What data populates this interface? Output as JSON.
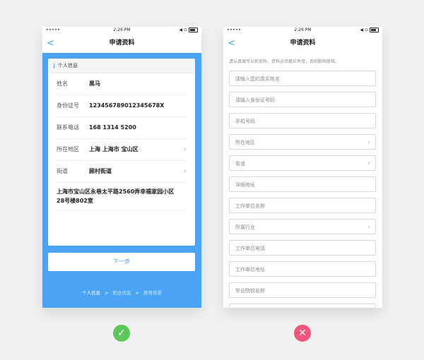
{
  "statusbar": {
    "signal": "•••••",
    "time": "2:26 PM",
    "icons": "◀ ⊙"
  },
  "nav": {
    "back_icon": "<",
    "title": "申请资料"
  },
  "left": {
    "section_title": "个人信息",
    "fields": [
      {
        "label": "姓名",
        "value": "黑马",
        "chevron": false
      },
      {
        "label": "身份证号",
        "value": "123456789012345678X",
        "chevron": false
      },
      {
        "label": "联系电话",
        "value": "168 1314 5200",
        "chevron": false
      },
      {
        "label": "所在地区",
        "value": "上海 上海市 宝山区",
        "chevron": true
      },
      {
        "label": "街道",
        "value": "顾村街道",
        "chevron": true
      }
    ],
    "address_line1": "上海市宝山区永巷太平路2560弄幸福家园小区",
    "address_line2": "28号楼802室",
    "next_button": "下一步",
    "steps": [
      "个人信息",
      "职业信息",
      "教育背景"
    ],
    "step_sep": ">"
  },
  "right": {
    "notice": "请认真填写以前资料，资料必须真实有效，否则影响审核。",
    "inputs": [
      {
        "text": "请输入您的真实姓名",
        "chevron": false
      },
      {
        "text": "请输入身份证号码",
        "chevron": false
      },
      {
        "text": "手机号码",
        "chevron": false
      },
      {
        "text": "所在地区",
        "chevron": true
      },
      {
        "text": "街道",
        "chevron": true
      },
      {
        "text": "详细地址",
        "chevron": false
      },
      {
        "text": "工作单位名称",
        "chevron": false
      },
      {
        "text": "所属行业",
        "chevron": true
      },
      {
        "text": "工作单位电话",
        "chevron": false
      },
      {
        "text": "工作单位地址",
        "chevron": false
      },
      {
        "text": "毕业院校名称",
        "chevron": false
      },
      {
        "text": "",
        "chevron": false
      }
    ]
  },
  "verdict": {
    "good_icon": "✓",
    "good_color": "#5cc75a",
    "bad_icon": "✕",
    "bad_color": "#f2557a"
  },
  "colors": {
    "accent": "#4aa3f3"
  }
}
